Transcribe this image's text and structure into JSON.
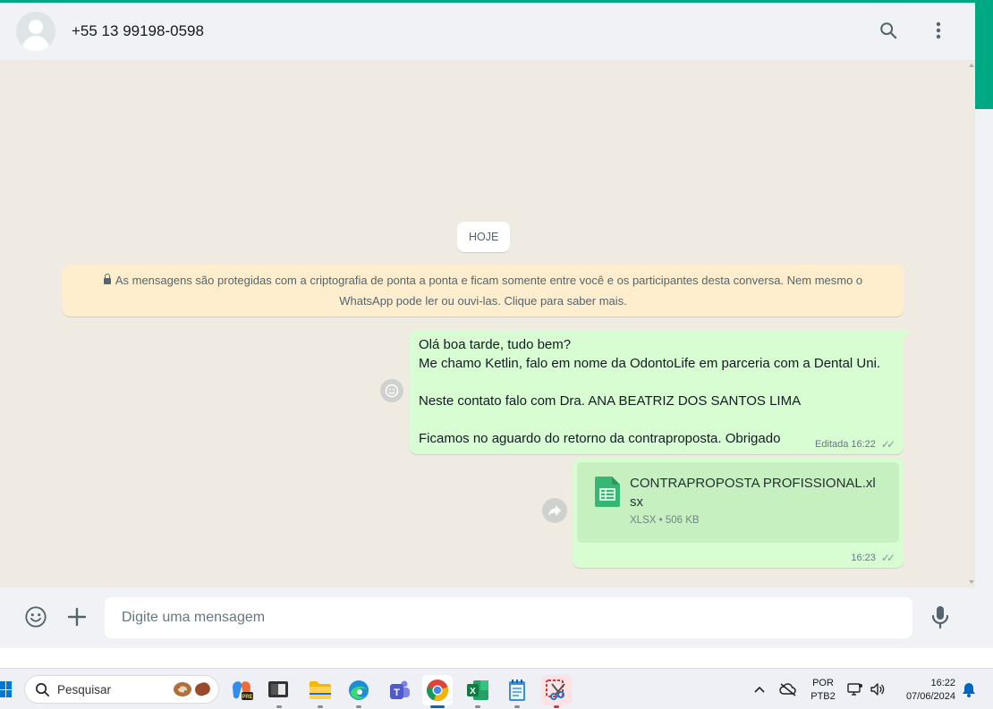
{
  "header": {
    "contact": "+55 13 99198-0598",
    "icons": [
      "search-icon",
      "menu-icon"
    ]
  },
  "chat": {
    "date_chip": "HOJE",
    "e2e_notice": "As mensagens são protegidas com a criptografia de ponta a ponta e ficam somente entre você e os participantes desta conversa. Nem mesmo o WhatsApp pode ler ou ouvi-las. Clique para saber mais.",
    "messages": [
      {
        "text": "Olá boa tarde, tudo bem?\nMe chamo Ketlin, falo em nome da OdontoLife em parceria com a Dental Uni.\n\nNeste contato falo com Dra. ANA BEATRIZ DOS SANTOS LIMA\n\nFicamos no aguardo do retorno da contraproposta. Obrigado",
        "edited_label": "Editada",
        "time": "16:22",
        "status": "read-ticks"
      },
      {
        "file_name": "CONTRAPROPOSTA PROFISSIONAL.xlsx",
        "file_type": "XLSX",
        "file_size": "506 KB",
        "time": "16:23",
        "status": "read-ticks"
      }
    ]
  },
  "composer": {
    "placeholder": "Digite uma mensagem"
  },
  "taskbar": {
    "search_label": "Pesquisar",
    "apps": [
      "copilot",
      "terminal",
      "file-explorer",
      "edge",
      "teams",
      "chrome",
      "excel",
      "notepad",
      "snipping-tool"
    ],
    "lang_line1": "POR",
    "lang_line2": "PTB2",
    "time": "16:22",
    "date": "07/06/2024"
  },
  "colors": {
    "accent": "#00a884",
    "outgoing_bubble": "#d9fdd3",
    "notice_bg": "#ffeecd",
    "chat_bg": "#efeae2"
  }
}
